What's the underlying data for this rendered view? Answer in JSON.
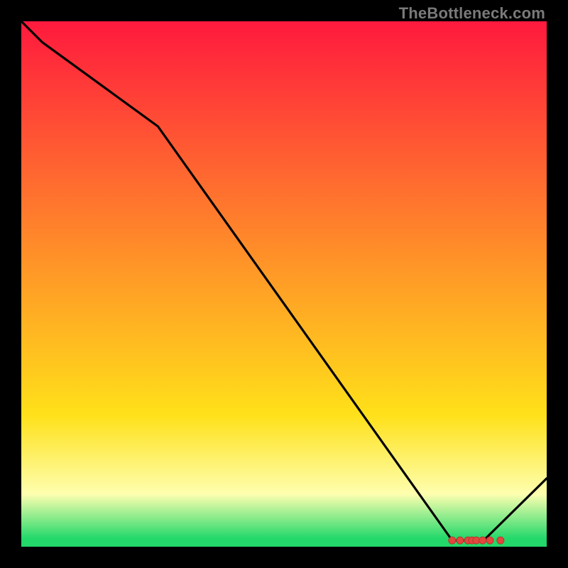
{
  "watermark": "TheBottleneck.com",
  "colors": {
    "black": "#000000",
    "curve": "#000000",
    "marker_fill": "#e2493c",
    "marker_stroke": "#b43a30",
    "grad_top": "#ff1a3e",
    "grad_mid_upper": "#ff8a2a",
    "grad_mid": "#ffe11a",
    "grad_band": "#feffb0",
    "grad_green": "#22d96a"
  },
  "chart_data": {
    "type": "line",
    "title": "",
    "xlabel": "",
    "ylabel": "",
    "xlim": [
      0,
      100
    ],
    "ylim": [
      0,
      100
    ],
    "x": [
      0,
      4,
      26,
      82,
      88,
      100
    ],
    "values": [
      100,
      96,
      80,
      1.2,
      1.2,
      13
    ],
    "markers": {
      "x": [
        82,
        83.5,
        85,
        85.8,
        86.6,
        87.8,
        89.2,
        91.2
      ],
      "y": [
        1.2,
        1.2,
        1.2,
        1.2,
        1.2,
        1.2,
        1.2,
        1.2
      ]
    },
    "gradient_stops": [
      {
        "offset": 0.0,
        "color": "#ff1a3e"
      },
      {
        "offset": 0.42,
        "color": "#ff8a2a"
      },
      {
        "offset": 0.75,
        "color": "#ffe11a"
      },
      {
        "offset": 0.9,
        "color": "#feffb0"
      },
      {
        "offset": 0.985,
        "color": "#22d96a"
      }
    ]
  }
}
